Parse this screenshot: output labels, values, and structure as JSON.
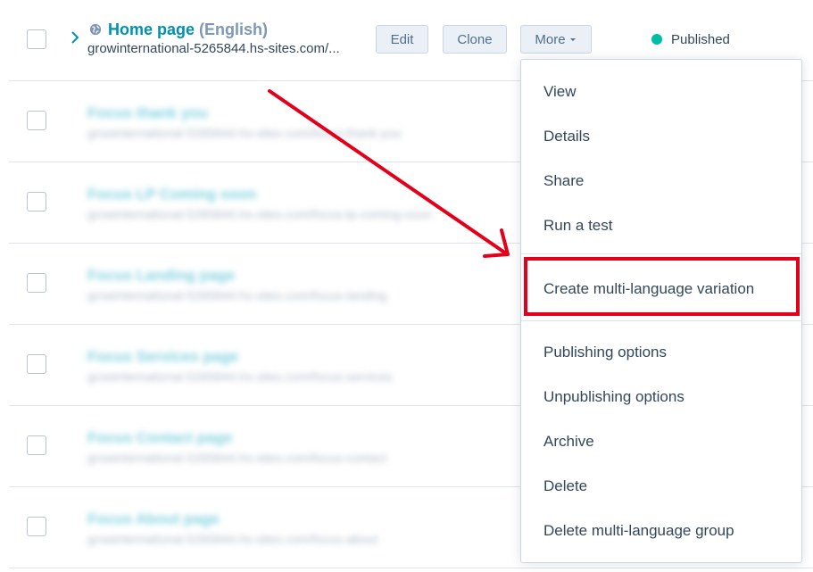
{
  "first_row": {
    "title": "Home page",
    "language": "(English)",
    "url": "growinternational-5265844.hs-sites.com/...",
    "buttons": {
      "edit": "Edit",
      "clone": "Clone",
      "more": "More"
    },
    "status": "Published"
  },
  "blurred_rows": [
    {
      "title": "Focus thank you",
      "url": "growinternational-5265844.hs-sites.com/focus-thank-you"
    },
    {
      "title": "Focus LP Coming soon",
      "url": "growinternational-5265844.hs-sites.com/focus-lp-coming-soon"
    },
    {
      "title": "Focus Landing page",
      "url": "growinternational-5265844.hs-sites.com/focus-landing"
    },
    {
      "title": "Focus Services page",
      "url": "growinternational-5265844.hs-sites.com/focus-services"
    },
    {
      "title": "Focus Contact page",
      "url": "growinternational-5265844.hs-sites.com/focus-contact"
    },
    {
      "title": "Focus About page",
      "url": "growinternational-5265844.hs-sites.com/focus-about"
    }
  ],
  "menu": {
    "items": [
      "View",
      "Details",
      "Share",
      "Run a test",
      "Create multi-language variation",
      "Publishing options",
      "Unpublishing options",
      "Archive",
      "Delete",
      "Delete multi-language group"
    ]
  },
  "colors": {
    "accent": "#0091ae",
    "published": "#00bda5",
    "annotation": "#e3001b"
  }
}
